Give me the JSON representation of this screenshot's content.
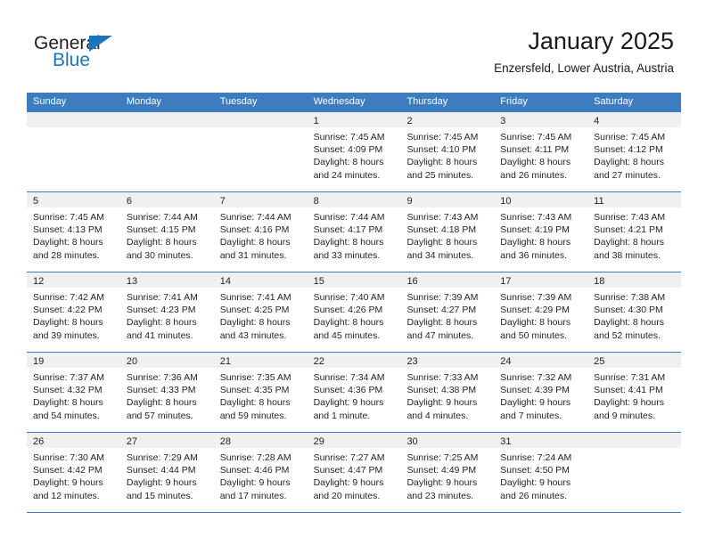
{
  "brand": {
    "name_part1": "General",
    "name_part2": "Blue",
    "logo_icon": "triangle-flag-icon"
  },
  "header": {
    "title": "January 2025",
    "location": "Enzersfeld, Lower Austria, Austria"
  },
  "calendar": {
    "weekdays": [
      "Sunday",
      "Monday",
      "Tuesday",
      "Wednesday",
      "Thursday",
      "Friday",
      "Saturday"
    ],
    "accent_color": "#3d7cbf",
    "daynum_band_color": "#f0f0f0",
    "weeks": [
      [
        {
          "day": "",
          "sunrise": "",
          "sunset": "",
          "daylight1": "",
          "daylight2": ""
        },
        {
          "day": "",
          "sunrise": "",
          "sunset": "",
          "daylight1": "",
          "daylight2": ""
        },
        {
          "day": "",
          "sunrise": "",
          "sunset": "",
          "daylight1": "",
          "daylight2": ""
        },
        {
          "day": "1",
          "sunrise": "Sunrise: 7:45 AM",
          "sunset": "Sunset: 4:09 PM",
          "daylight1": "Daylight: 8 hours",
          "daylight2": "and 24 minutes."
        },
        {
          "day": "2",
          "sunrise": "Sunrise: 7:45 AM",
          "sunset": "Sunset: 4:10 PM",
          "daylight1": "Daylight: 8 hours",
          "daylight2": "and 25 minutes."
        },
        {
          "day": "3",
          "sunrise": "Sunrise: 7:45 AM",
          "sunset": "Sunset: 4:11 PM",
          "daylight1": "Daylight: 8 hours",
          "daylight2": "and 26 minutes."
        },
        {
          "day": "4",
          "sunrise": "Sunrise: 7:45 AM",
          "sunset": "Sunset: 4:12 PM",
          "daylight1": "Daylight: 8 hours",
          "daylight2": "and 27 minutes."
        }
      ],
      [
        {
          "day": "5",
          "sunrise": "Sunrise: 7:45 AM",
          "sunset": "Sunset: 4:13 PM",
          "daylight1": "Daylight: 8 hours",
          "daylight2": "and 28 minutes."
        },
        {
          "day": "6",
          "sunrise": "Sunrise: 7:44 AM",
          "sunset": "Sunset: 4:15 PM",
          "daylight1": "Daylight: 8 hours",
          "daylight2": "and 30 minutes."
        },
        {
          "day": "7",
          "sunrise": "Sunrise: 7:44 AM",
          "sunset": "Sunset: 4:16 PM",
          "daylight1": "Daylight: 8 hours",
          "daylight2": "and 31 minutes."
        },
        {
          "day": "8",
          "sunrise": "Sunrise: 7:44 AM",
          "sunset": "Sunset: 4:17 PM",
          "daylight1": "Daylight: 8 hours",
          "daylight2": "and 33 minutes."
        },
        {
          "day": "9",
          "sunrise": "Sunrise: 7:43 AM",
          "sunset": "Sunset: 4:18 PM",
          "daylight1": "Daylight: 8 hours",
          "daylight2": "and 34 minutes."
        },
        {
          "day": "10",
          "sunrise": "Sunrise: 7:43 AM",
          "sunset": "Sunset: 4:19 PM",
          "daylight1": "Daylight: 8 hours",
          "daylight2": "and 36 minutes."
        },
        {
          "day": "11",
          "sunrise": "Sunrise: 7:43 AM",
          "sunset": "Sunset: 4:21 PM",
          "daylight1": "Daylight: 8 hours",
          "daylight2": "and 38 minutes."
        }
      ],
      [
        {
          "day": "12",
          "sunrise": "Sunrise: 7:42 AM",
          "sunset": "Sunset: 4:22 PM",
          "daylight1": "Daylight: 8 hours",
          "daylight2": "and 39 minutes."
        },
        {
          "day": "13",
          "sunrise": "Sunrise: 7:41 AM",
          "sunset": "Sunset: 4:23 PM",
          "daylight1": "Daylight: 8 hours",
          "daylight2": "and 41 minutes."
        },
        {
          "day": "14",
          "sunrise": "Sunrise: 7:41 AM",
          "sunset": "Sunset: 4:25 PM",
          "daylight1": "Daylight: 8 hours",
          "daylight2": "and 43 minutes."
        },
        {
          "day": "15",
          "sunrise": "Sunrise: 7:40 AM",
          "sunset": "Sunset: 4:26 PM",
          "daylight1": "Daylight: 8 hours",
          "daylight2": "and 45 minutes."
        },
        {
          "day": "16",
          "sunrise": "Sunrise: 7:39 AM",
          "sunset": "Sunset: 4:27 PM",
          "daylight1": "Daylight: 8 hours",
          "daylight2": "and 47 minutes."
        },
        {
          "day": "17",
          "sunrise": "Sunrise: 7:39 AM",
          "sunset": "Sunset: 4:29 PM",
          "daylight1": "Daylight: 8 hours",
          "daylight2": "and 50 minutes."
        },
        {
          "day": "18",
          "sunrise": "Sunrise: 7:38 AM",
          "sunset": "Sunset: 4:30 PM",
          "daylight1": "Daylight: 8 hours",
          "daylight2": "and 52 minutes."
        }
      ],
      [
        {
          "day": "19",
          "sunrise": "Sunrise: 7:37 AM",
          "sunset": "Sunset: 4:32 PM",
          "daylight1": "Daylight: 8 hours",
          "daylight2": "and 54 minutes."
        },
        {
          "day": "20",
          "sunrise": "Sunrise: 7:36 AM",
          "sunset": "Sunset: 4:33 PM",
          "daylight1": "Daylight: 8 hours",
          "daylight2": "and 57 minutes."
        },
        {
          "day": "21",
          "sunrise": "Sunrise: 7:35 AM",
          "sunset": "Sunset: 4:35 PM",
          "daylight1": "Daylight: 8 hours",
          "daylight2": "and 59 minutes."
        },
        {
          "day": "22",
          "sunrise": "Sunrise: 7:34 AM",
          "sunset": "Sunset: 4:36 PM",
          "daylight1": "Daylight: 9 hours",
          "daylight2": "and 1 minute."
        },
        {
          "day": "23",
          "sunrise": "Sunrise: 7:33 AM",
          "sunset": "Sunset: 4:38 PM",
          "daylight1": "Daylight: 9 hours",
          "daylight2": "and 4 minutes."
        },
        {
          "day": "24",
          "sunrise": "Sunrise: 7:32 AM",
          "sunset": "Sunset: 4:39 PM",
          "daylight1": "Daylight: 9 hours",
          "daylight2": "and 7 minutes."
        },
        {
          "day": "25",
          "sunrise": "Sunrise: 7:31 AM",
          "sunset": "Sunset: 4:41 PM",
          "daylight1": "Daylight: 9 hours",
          "daylight2": "and 9 minutes."
        }
      ],
      [
        {
          "day": "26",
          "sunrise": "Sunrise: 7:30 AM",
          "sunset": "Sunset: 4:42 PM",
          "daylight1": "Daylight: 9 hours",
          "daylight2": "and 12 minutes."
        },
        {
          "day": "27",
          "sunrise": "Sunrise: 7:29 AM",
          "sunset": "Sunset: 4:44 PM",
          "daylight1": "Daylight: 9 hours",
          "daylight2": "and 15 minutes."
        },
        {
          "day": "28",
          "sunrise": "Sunrise: 7:28 AM",
          "sunset": "Sunset: 4:46 PM",
          "daylight1": "Daylight: 9 hours",
          "daylight2": "and 17 minutes."
        },
        {
          "day": "29",
          "sunrise": "Sunrise: 7:27 AM",
          "sunset": "Sunset: 4:47 PM",
          "daylight1": "Daylight: 9 hours",
          "daylight2": "and 20 minutes."
        },
        {
          "day": "30",
          "sunrise": "Sunrise: 7:25 AM",
          "sunset": "Sunset: 4:49 PM",
          "daylight1": "Daylight: 9 hours",
          "daylight2": "and 23 minutes."
        },
        {
          "day": "31",
          "sunrise": "Sunrise: 7:24 AM",
          "sunset": "Sunset: 4:50 PM",
          "daylight1": "Daylight: 9 hours",
          "daylight2": "and 26 minutes."
        },
        {
          "day": "",
          "sunrise": "",
          "sunset": "",
          "daylight1": "",
          "daylight2": ""
        }
      ]
    ]
  }
}
